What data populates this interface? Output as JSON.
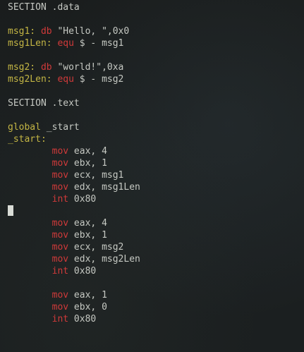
{
  "editor": {
    "lines": [
      [
        {
          "text": "SECTION .data",
          "style": "plain"
        }
      ],
      [],
      [
        {
          "text": "msg1:",
          "style": "label"
        },
        {
          "text": " ",
          "style": "plain"
        },
        {
          "text": "db",
          "style": "keyword"
        },
        {
          "text": " \"Hello, \",0x0",
          "style": "plain"
        }
      ],
      [
        {
          "text": "msg1Len:",
          "style": "label"
        },
        {
          "text": " ",
          "style": "plain"
        },
        {
          "text": "equ",
          "style": "keyword"
        },
        {
          "text": " $ - msg1",
          "style": "plain"
        }
      ],
      [],
      [
        {
          "text": "msg2:",
          "style": "label"
        },
        {
          "text": " ",
          "style": "plain"
        },
        {
          "text": "db",
          "style": "keyword"
        },
        {
          "text": " \"world!\",0xa",
          "style": "plain"
        }
      ],
      [
        {
          "text": "msg2Len:",
          "style": "label"
        },
        {
          "text": " ",
          "style": "plain"
        },
        {
          "text": "equ",
          "style": "keyword"
        },
        {
          "text": " $ - msg2",
          "style": "plain"
        }
      ],
      [],
      [
        {
          "text": "SECTION .text",
          "style": "plain"
        }
      ],
      [],
      [
        {
          "text": "global",
          "style": "label"
        },
        {
          "text": " _start",
          "style": "plain"
        }
      ],
      [
        {
          "text": "_start:",
          "style": "label"
        }
      ],
      [
        {
          "text": "        ",
          "style": "plain"
        },
        {
          "text": "mov",
          "style": "keyword"
        },
        {
          "text": " eax, 4",
          "style": "plain"
        }
      ],
      [
        {
          "text": "        ",
          "style": "plain"
        },
        {
          "text": "mov",
          "style": "keyword"
        },
        {
          "text": " ebx, 1",
          "style": "plain"
        }
      ],
      [
        {
          "text": "        ",
          "style": "plain"
        },
        {
          "text": "mov",
          "style": "keyword"
        },
        {
          "text": " ecx, msg1",
          "style": "plain"
        }
      ],
      [
        {
          "text": "        ",
          "style": "plain"
        },
        {
          "text": "mov",
          "style": "keyword"
        },
        {
          "text": " edx, msg1Len",
          "style": "plain"
        }
      ],
      [
        {
          "text": "        ",
          "style": "plain"
        },
        {
          "text": "int",
          "style": "keyword"
        },
        {
          "text": " 0x80",
          "style": "plain"
        }
      ],
      [
        {
          "cursor": true
        }
      ],
      [
        {
          "text": "        ",
          "style": "plain"
        },
        {
          "text": "mov",
          "style": "keyword"
        },
        {
          "text": " eax, 4",
          "style": "plain"
        }
      ],
      [
        {
          "text": "        ",
          "style": "plain"
        },
        {
          "text": "mov",
          "style": "keyword"
        },
        {
          "text": " ebx, 1",
          "style": "plain"
        }
      ],
      [
        {
          "text": "        ",
          "style": "plain"
        },
        {
          "text": "mov",
          "style": "keyword"
        },
        {
          "text": " ecx, msg2",
          "style": "plain"
        }
      ],
      [
        {
          "text": "        ",
          "style": "plain"
        },
        {
          "text": "mov",
          "style": "keyword"
        },
        {
          "text": " edx, msg2Len",
          "style": "plain"
        }
      ],
      [
        {
          "text": "        ",
          "style": "plain"
        },
        {
          "text": "int",
          "style": "keyword"
        },
        {
          "text": " 0x80",
          "style": "plain"
        }
      ],
      [],
      [
        {
          "text": "        ",
          "style": "plain"
        },
        {
          "text": "mov",
          "style": "keyword"
        },
        {
          "text": " eax, 1",
          "style": "plain"
        }
      ],
      [
        {
          "text": "        ",
          "style": "plain"
        },
        {
          "text": "mov",
          "style": "keyword"
        },
        {
          "text": " ebx, 0",
          "style": "plain"
        }
      ],
      [
        {
          "text": "        ",
          "style": "plain"
        },
        {
          "text": "int",
          "style": "keyword"
        },
        {
          "text": " 0x80",
          "style": "plain"
        }
      ]
    ]
  },
  "colors": {
    "background": "#1b1f20",
    "plain_text": "#c6c9c3",
    "label": "#c3b544",
    "keyword": "#d03a3a",
    "cursor": "#d9dcd6"
  }
}
